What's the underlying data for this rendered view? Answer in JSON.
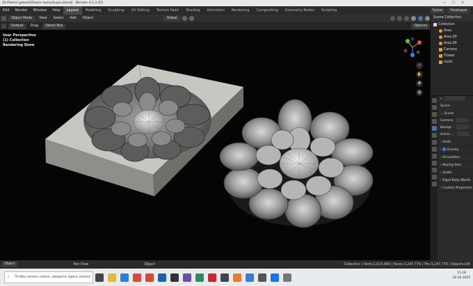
{
  "window": {
    "title": "[D:\\Pokrisi gotoshi/Dizain nomur/Lujos.blend] - Blender 4.2.3 LTS"
  },
  "menu": [
    "Edit",
    "Render",
    "Window",
    "Help"
  ],
  "workspaces": [
    "Layout",
    "Modeling",
    "Sculpting",
    "UV Editing",
    "Texture Paint",
    "Shading",
    "Animation",
    "Rendering",
    "Compositing",
    "Geometry Nodes",
    "Scripting"
  ],
  "top_right": {
    "scene": "Scene",
    "view_layer": "ViewLayer"
  },
  "viewport_header": {
    "mode": "Object Mode",
    "items": [
      "View",
      "Select",
      "Add",
      "Object"
    ],
    "transform": "Global",
    "options": "Options"
  },
  "toolbar": {
    "orientation": "Default",
    "drag": "Drag",
    "drag_mode": "Select Box"
  },
  "overlay": {
    "line1": "User Perspective",
    "line2": "(1) Collection",
    "line3": "Rendering Done"
  },
  "outliner": {
    "header": "Scene Collection",
    "items": [
      {
        "label": "Collection",
        "indent": 0
      },
      {
        "label": "Area",
        "indent": 1
      },
      {
        "label": "Area.00",
        "indent": 1
      },
      {
        "label": "Area.00",
        "indent": 1
      },
      {
        "label": "Camera",
        "indent": 1
      },
      {
        "label": "Flower",
        "indent": 1
      },
      {
        "label": "mold",
        "indent": 1
      }
    ]
  },
  "properties": {
    "search_placeholder": "",
    "scene_label": "Scene",
    "scene_section": "Scene",
    "camera_label": "Camera",
    "background_label": "Backgr...",
    "active_label": "Active ...",
    "sections": [
      "Units",
      "Gravity",
      "Simulation",
      "Keying Sets",
      "Audio",
      "Rigid Body World",
      "Custom Properties"
    ]
  },
  "statusbar": {
    "left": "Object",
    "middle": "Pan View",
    "middle2": "Object",
    "stats": "Collection | Verts:1,623,690 | Faces:3,247,776 | Tris:3,247,776 | Objects:0/6"
  },
  "taskbar": {
    "search_placeholder": "Чтобы начать поиск, введите здесь запрос",
    "time": "15:18",
    "date": "02.03.2025"
  },
  "colors": {
    "accent": "#4772b3",
    "object_orange": "#e89b3a",
    "collection_white": "#dddddd"
  }
}
